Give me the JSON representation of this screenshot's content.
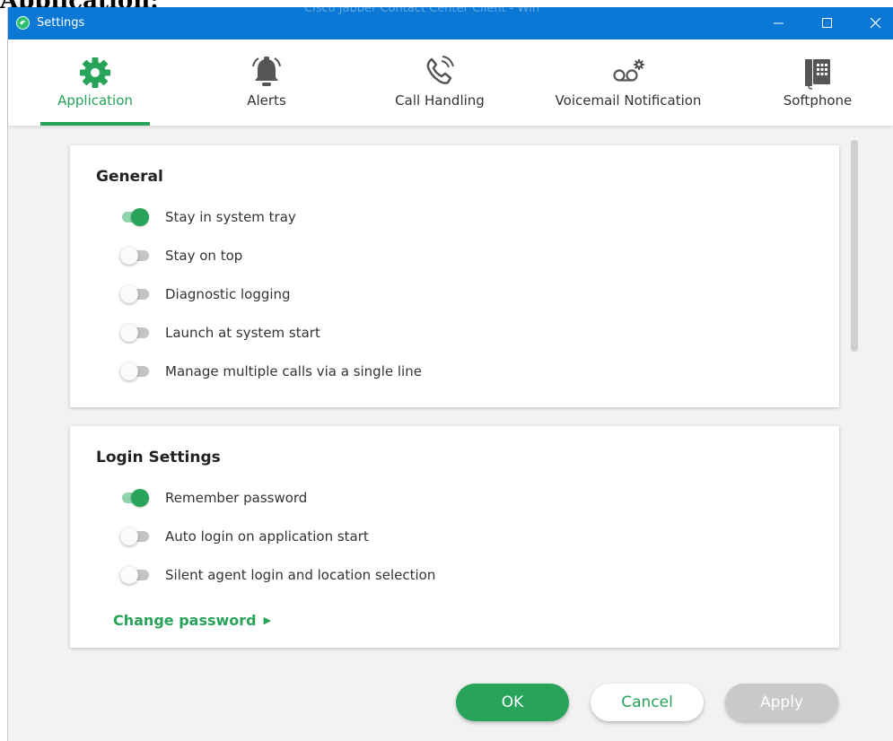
{
  "background_heading": "Application:",
  "window": {
    "title": "Settings",
    "ghost_title": "Cisco Jabber Contact Center Client - Win",
    "controls": [
      "—",
      "☐",
      "✕"
    ]
  },
  "tabs": [
    {
      "label": "Application",
      "icon": "gear-icon",
      "active": true
    },
    {
      "label": "Alerts",
      "icon": "bell-icon",
      "active": false
    },
    {
      "label": "Call Handling",
      "icon": "phone-icon",
      "active": false
    },
    {
      "label": "Voicemail Notification",
      "icon": "voicemail-icon",
      "active": false
    },
    {
      "label": "Softphone",
      "icon": "desk-phone-icon",
      "active": false
    }
  ],
  "general": {
    "title": "General",
    "items": [
      {
        "label": "Stay in system tray",
        "on": true
      },
      {
        "label": "Stay on top",
        "on": false
      },
      {
        "label": "Diagnostic logging",
        "on": false
      },
      {
        "label": "Launch at system start",
        "on": false
      },
      {
        "label": "Manage multiple calls via a single line",
        "on": false
      }
    ]
  },
  "login": {
    "title": "Login Settings",
    "items": [
      {
        "label": "Remember password",
        "on": true
      },
      {
        "label": "Auto login on application start",
        "on": false
      },
      {
        "label": "Silent agent login and location selection",
        "on": false
      }
    ],
    "change_password": "Change password"
  },
  "buttons": {
    "ok": "OK",
    "cancel": "Cancel",
    "apply": "Apply"
  },
  "colors": {
    "titlebar": "#0a78d4",
    "accent": "#27a35a",
    "disabled": "#c9c9c9"
  }
}
